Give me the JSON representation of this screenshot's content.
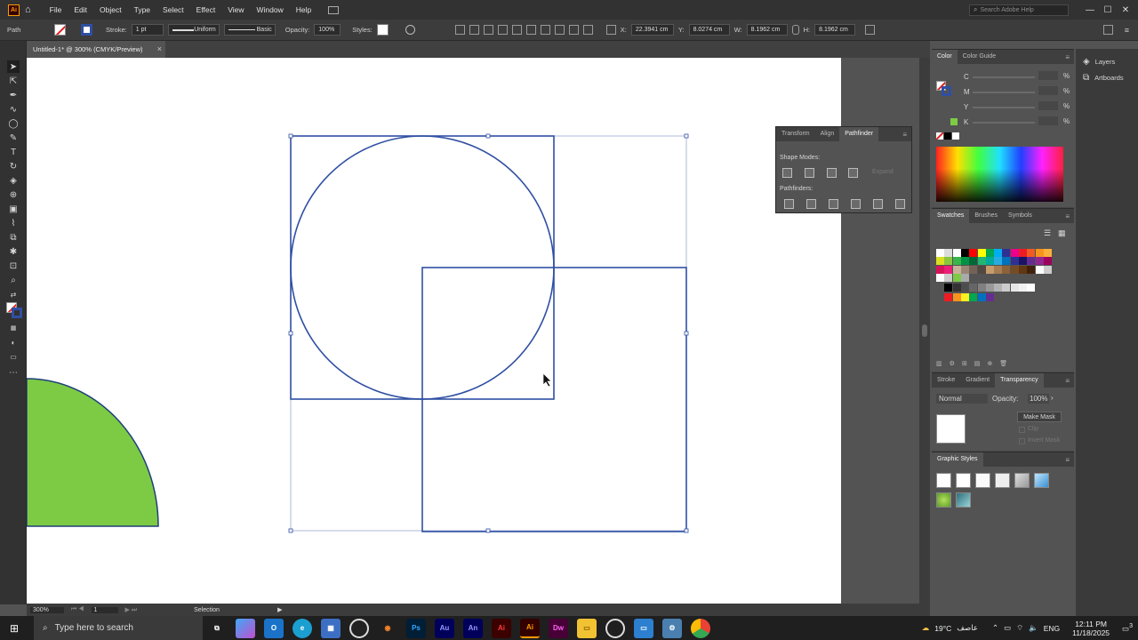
{
  "menubar": {
    "logo": "Ai",
    "items": [
      "File",
      "Edit",
      "Object",
      "Type",
      "Select",
      "Effect",
      "View",
      "Window",
      "Help"
    ],
    "search_placeholder": "Search Adobe Help",
    "min": "—",
    "max": "☐",
    "close": "✕"
  },
  "controlbar": {
    "object_type": "Path",
    "stroke_label": "Stroke:",
    "stroke_weight": "1 pt",
    "profile": "Uniform",
    "brush": "Basic",
    "opacity_label": "Opacity:",
    "opacity_value": "100%",
    "styles_label": "Styles:",
    "x_label": "X:",
    "x_value": "22.3941 cm",
    "y_label": "Y:",
    "y_value": "8.0274 cm",
    "w_label": "W:",
    "w_value": "8.1962 cm",
    "h_label": "H:",
    "h_value": "8.1962 cm"
  },
  "document": {
    "tab_title": "Untitled-1* @ 300% (CMYK/Preview)",
    "close": "×"
  },
  "statusbar": {
    "zoom": "300%",
    "artboard_number": "1",
    "tool_name": "Selection"
  },
  "color_panel": {
    "tabs": [
      "Color",
      "Color Guide"
    ],
    "channels": [
      "C",
      "M",
      "Y",
      "K"
    ],
    "percent": "%"
  },
  "layers_panel": {
    "items": [
      "Layers",
      "Artboards"
    ]
  },
  "pathfinder_panel": {
    "tabs": [
      "Transform",
      "Align",
      "Pathfinder"
    ],
    "shape_modes_label": "Shape Modes:",
    "expand_label": "Expand",
    "pathfinders_label": "Pathfinders:"
  },
  "swatches_panel": {
    "tabs": [
      "Swatches",
      "Brushes",
      "Symbols"
    ]
  },
  "transparency_panel": {
    "tabs": [
      "Stroke",
      "Gradient",
      "Transparency"
    ],
    "blend_mode": "Normal",
    "opacity_label": "Opacity:",
    "opacity_value": "100%",
    "make_mask": "Make Mask",
    "clip": "Clip",
    "invert_mask": "Invert Mask"
  },
  "graphic_styles_panel": {
    "title": "Graphic Styles"
  },
  "taskbar": {
    "search_placeholder": "Type here to search",
    "weather": "19°C",
    "weather_text": "عاصف",
    "language": "ENG",
    "time": "12:11 PM",
    "date": "11/18/2025",
    "notifications": "3"
  },
  "colors": {
    "accent_selection": "#2f4fa3",
    "shape_fill_green": "#7dcb45",
    "canvas_bg": "#535353",
    "ui_dark": "#323232"
  }
}
